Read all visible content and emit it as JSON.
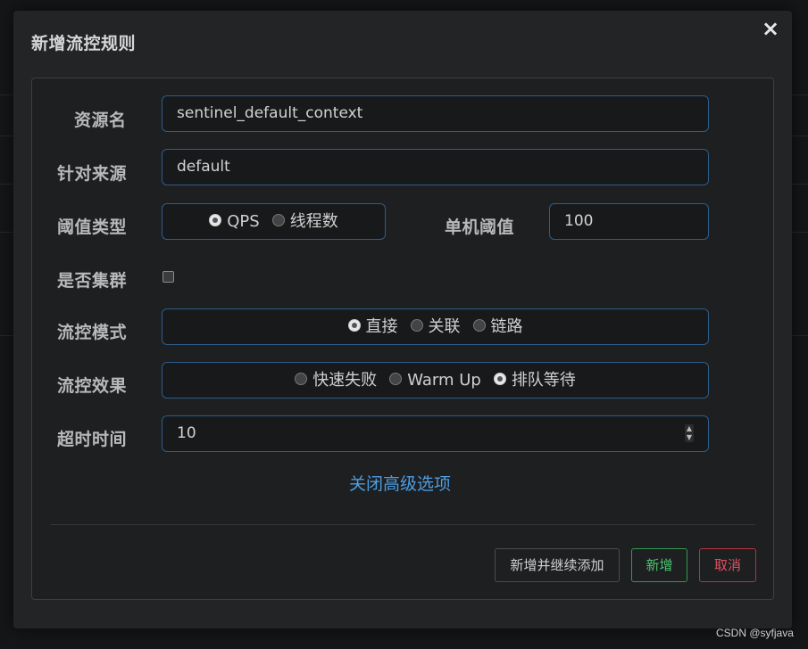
{
  "modal": {
    "title": "新增流控规则",
    "close_icon": "×"
  },
  "form": {
    "resource": {
      "label": "资源名",
      "value": "sentinel_default_context"
    },
    "limit_app": {
      "label": "针对来源",
      "value": "default"
    },
    "grade": {
      "label": "阈值类型",
      "options": [
        {
          "label": "QPS",
          "checked": true
        },
        {
          "label": "线程数",
          "checked": false
        }
      ]
    },
    "count": {
      "label": "单机阈值",
      "value": "100"
    },
    "cluster": {
      "label": "是否集群",
      "checked": false
    },
    "strategy": {
      "label": "流控模式",
      "options": [
        {
          "label": "直接",
          "checked": true
        },
        {
          "label": "关联",
          "checked": false
        },
        {
          "label": "链路",
          "checked": false
        }
      ]
    },
    "control_behavior": {
      "label": "流控效果",
      "options": [
        {
          "label": "快速失败",
          "checked": false
        },
        {
          "label": "Warm Up",
          "checked": false
        },
        {
          "label": "排队等待",
          "checked": true
        }
      ]
    },
    "timeout": {
      "label": "超时时间",
      "value": "10"
    },
    "advanced_link": "关闭高级选项"
  },
  "footer": {
    "add_continue": "新增并继续添加",
    "add": "新增",
    "cancel": "取消"
  },
  "watermark": "CSDN @syfjava",
  "colors": {
    "accent_link": "#4d9de0",
    "success": "#4cc46e",
    "danger": "#e0505e",
    "field_border": "#2f5d8a"
  }
}
